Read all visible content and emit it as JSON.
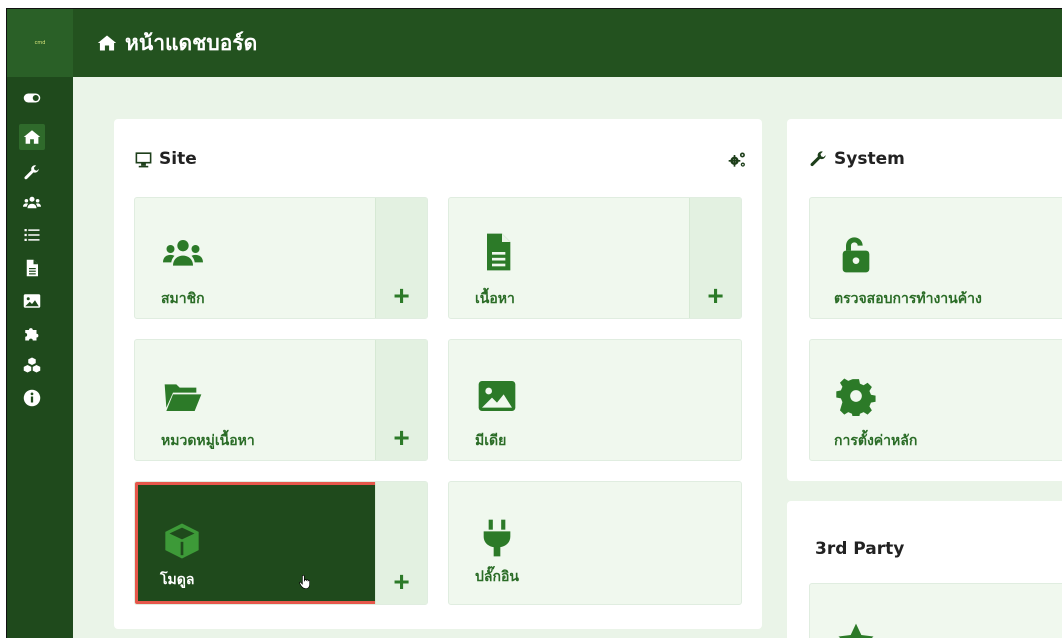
{
  "app": {
    "logo_text": "cmd",
    "page_title": "หน้าแดชบอร์ด"
  },
  "sidebar": {
    "icons": [
      "toggle-icon",
      "home-icon",
      "wrench-icon",
      "users-icon",
      "list-icon",
      "file-icon",
      "image-icon",
      "puzzle-icon",
      "cubes-icon",
      "info-icon"
    ]
  },
  "site_panel": {
    "title": "Site",
    "tiles": [
      {
        "label": "สมาชิก",
        "icon": "users-icon",
        "add": "+"
      },
      {
        "label": "เนื้อหา",
        "icon": "file-icon",
        "add": "+"
      },
      {
        "label": "หมวดหมู่เนื้อหา",
        "icon": "folder-icon",
        "add": "+"
      },
      {
        "label": "มีเดีย",
        "icon": "image-icon"
      },
      {
        "label": "โมดูล",
        "icon": "cube-icon",
        "add": "+"
      },
      {
        "label": "ปลั๊กอิน",
        "icon": "plug-icon"
      }
    ]
  },
  "system_panel": {
    "title": "System",
    "tiles": [
      {
        "label": "ตรวจสอบการทำงานค้าง",
        "icon": "unlock-icon"
      },
      {
        "label": "การตั้งค่าหลัก",
        "icon": "cog-icon"
      }
    ]
  },
  "third_party_panel": {
    "title": "3rd Party"
  },
  "colors": {
    "sidebar": "#1f4a1c",
    "topbar": "#23521f",
    "accent": "#2c7a28",
    "highlight_border": "#e6574b"
  }
}
